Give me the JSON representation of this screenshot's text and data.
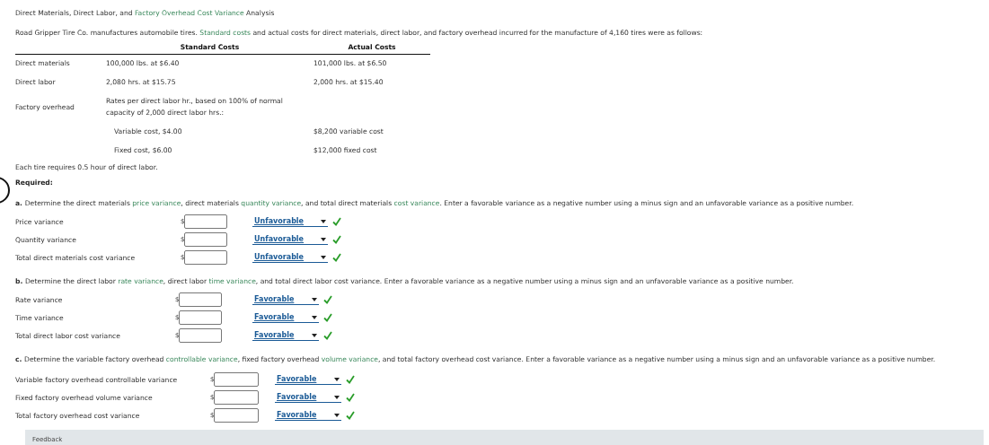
{
  "title": [
    {
      "kind": "plain",
      "text": "Direct Materials, Direct Labor, and "
    },
    {
      "kind": "term",
      "text": "Factory Overhead Cost Variance"
    },
    {
      "kind": "plain",
      "text": " Analysis"
    }
  ],
  "intro": [
    {
      "kind": "plain",
      "text": "Road Gripper Tire Co. manufactures automobile tires. "
    },
    {
      "kind": "term",
      "text": "Standard costs"
    },
    {
      "kind": "plain",
      "text": " and actual costs for direct materials, direct labor, and factory overhead incurred for the manufacture of 4,160 tires were as follows:"
    }
  ],
  "cost_table": {
    "columns": [
      "Standard Costs",
      "Actual Costs"
    ],
    "rows": [
      {
        "label": "Direct materials",
        "standard": [
          "100,000 lbs. at $6.40"
        ],
        "actual": "101,000 lbs. at $6.50",
        "indent": false
      },
      {
        "label": "Direct labor",
        "standard": [
          "2,080 hrs. at $15.75"
        ],
        "actual": "2,000 hrs. at $15.40",
        "indent": false
      },
      {
        "label": "Factory overhead",
        "standard": [
          "Rates per direct labor hr., based on 100% of normal",
          "capacity of 2,000 direct labor hrs.:"
        ],
        "actual": "",
        "indent": false
      },
      {
        "label": "",
        "standard": [
          "Variable cost, $4.00"
        ],
        "actual": "$8,200 variable cost",
        "indent": true
      },
      {
        "label": "",
        "standard": [
          "Fixed cost, $6.00"
        ],
        "actual": "$12,000 fixed cost",
        "indent": true
      }
    ]
  },
  "note": "Each tire requires 0.5 hour of direct labor.",
  "required": "Required:",
  "parts": [
    {
      "letter": "a.",
      "instructions": [
        {
          "kind": "plain",
          "text": "Determine the direct materials "
        },
        {
          "kind": "term",
          "text": "price variance"
        },
        {
          "kind": "plain",
          "text": ", direct materials "
        },
        {
          "kind": "term",
          "text": "quantity variance"
        },
        {
          "kind": "plain",
          "text": ", and total direct materials "
        },
        {
          "kind": "term",
          "text": "cost variance"
        },
        {
          "kind": "plain",
          "text": ". Enter a favorable variance as a negative number using a minus sign and an unfavorable variance as a positive number."
        }
      ],
      "answers": [
        {
          "label": "Price variance",
          "currency": "$",
          "choice": "Unfavorable",
          "correct": true
        },
        {
          "label": "Quantity variance",
          "currency": "$",
          "choice": "Unfavorable",
          "correct": true
        },
        {
          "label": "Total direct materials cost variance",
          "currency": "$",
          "choice": "Unfavorable",
          "correct": true
        }
      ]
    },
    {
      "letter": "b.",
      "instructions": [
        {
          "kind": "plain",
          "text": "Determine the direct labor "
        },
        {
          "kind": "term",
          "text": "rate variance"
        },
        {
          "kind": "plain",
          "text": ", direct labor "
        },
        {
          "kind": "term",
          "text": "time variance"
        },
        {
          "kind": "plain",
          "text": ", and total direct labor cost variance. Enter a favorable variance as a negative number using a minus sign and an unfavorable variance as a positive number."
        }
      ],
      "answers": [
        {
          "label": "Rate variance",
          "currency": "$",
          "choice": "Favorable",
          "correct": true
        },
        {
          "label": "Time variance",
          "currency": "$",
          "choice": "Favorable",
          "correct": true
        },
        {
          "label": "Total direct labor cost variance",
          "currency": "$",
          "choice": "Favorable",
          "correct": true
        }
      ]
    },
    {
      "letter": "c.",
      "instructions": [
        {
          "kind": "plain",
          "text": "Determine the variable factory overhead "
        },
        {
          "kind": "term",
          "text": "controllable variance"
        },
        {
          "kind": "plain",
          "text": ", fixed factory overhead "
        },
        {
          "kind": "term",
          "text": "volume variance"
        },
        {
          "kind": "plain",
          "text": ", and total factory overhead cost variance. Enter a favorable variance as a negative number using a minus sign and an unfavorable variance as a positive number."
        }
      ],
      "answers": [
        {
          "label": "Variable factory overhead controllable variance",
          "currency": "$",
          "choice": "Favorable",
          "correct": true
        },
        {
          "label": "Fixed factory overhead volume variance",
          "currency": "$",
          "choice": "Favorable",
          "correct": true
        },
        {
          "label": "Total factory overhead cost variance",
          "currency": "$",
          "choice": "Favorable",
          "correct": true
        }
      ]
    }
  ],
  "feedback": {
    "label": "Feedback"
  }
}
